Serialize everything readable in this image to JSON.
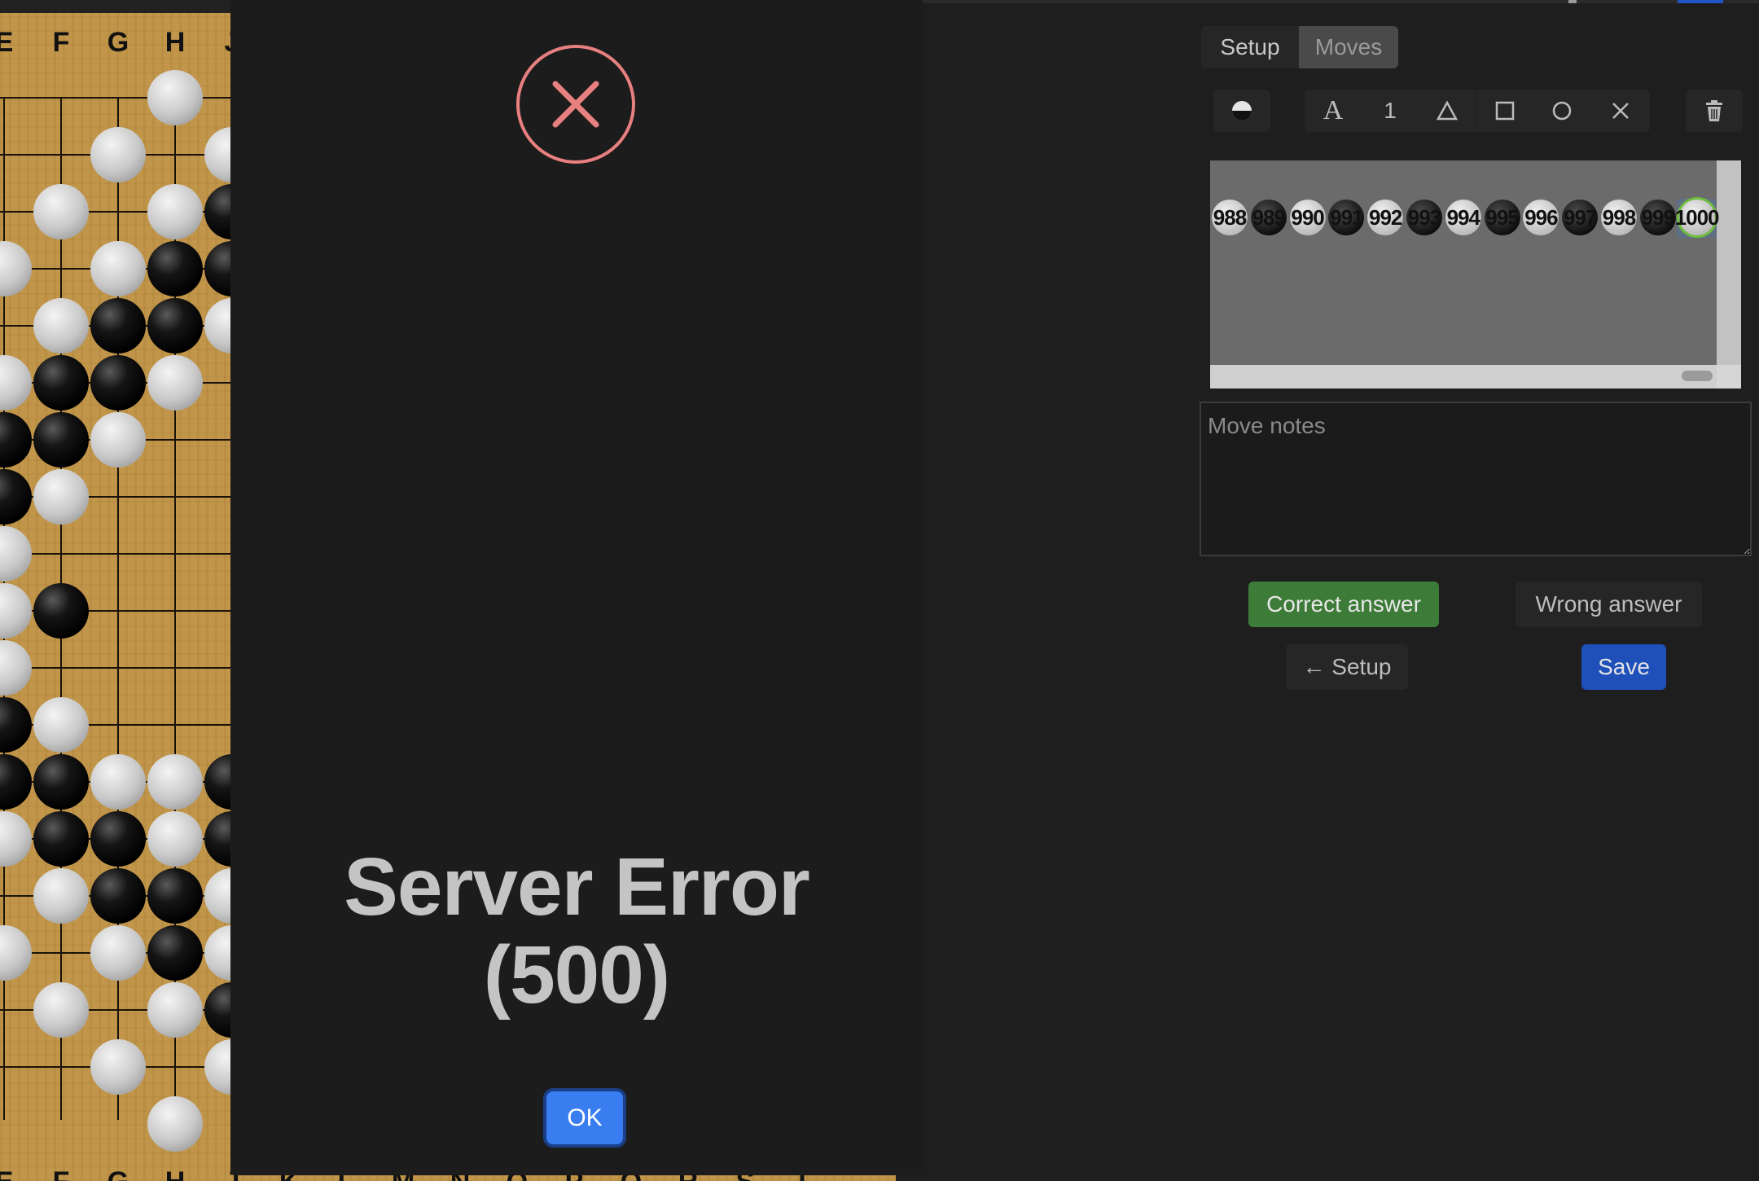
{
  "board": {
    "top_coordinates": [
      "E",
      "F",
      "G",
      "H",
      "J"
    ],
    "bottom_coordinates": [
      "E",
      "F",
      "G",
      "H",
      "J",
      "K",
      "L",
      "M",
      "N",
      "O",
      "P",
      "Q",
      "R",
      "S",
      "T"
    ],
    "stone_colors": {
      "black": "#111111",
      "white": "#c9c9c9"
    }
  },
  "modal": {
    "icon": "x-circle-icon",
    "title": "Server Error (500)",
    "ok_label": "OK",
    "colors": {
      "icon": "#e98080",
      "ok_button": "#3a7df0"
    }
  },
  "editor": {
    "tabs": [
      {
        "label": "Setup",
        "active": false
      },
      {
        "label": "Moves",
        "active": true
      }
    ],
    "tools": [
      "stone-color-icon",
      "letter-icon",
      "number-icon",
      "triangle-icon",
      "square-icon",
      "circle-icon",
      "cross-icon",
      "trash-icon"
    ],
    "tool_labels": {
      "letter": "A",
      "number": "1"
    },
    "move_tree": {
      "nodes": [
        {
          "label": "988",
          "color": "white"
        },
        {
          "label": "989",
          "color": "black"
        },
        {
          "label": "990",
          "color": "white"
        },
        {
          "label": "991",
          "color": "black"
        },
        {
          "label": "992",
          "color": "white"
        },
        {
          "label": "993",
          "color": "black"
        },
        {
          "label": "994",
          "color": "white"
        },
        {
          "label": "995",
          "color": "black"
        },
        {
          "label": "996",
          "color": "white"
        },
        {
          "label": "997",
          "color": "black"
        },
        {
          "label": "998",
          "color": "white"
        },
        {
          "label": "999",
          "color": "black"
        },
        {
          "label": "1000",
          "color": "white",
          "current": true
        }
      ]
    },
    "notes_placeholder": "Move notes",
    "buttons": {
      "correct": "Correct answer",
      "wrong": "Wrong answer",
      "back": "← Setup",
      "save": "Save"
    },
    "colors": {
      "correct": "#3d7b39",
      "save": "#1f4fb9"
    }
  }
}
